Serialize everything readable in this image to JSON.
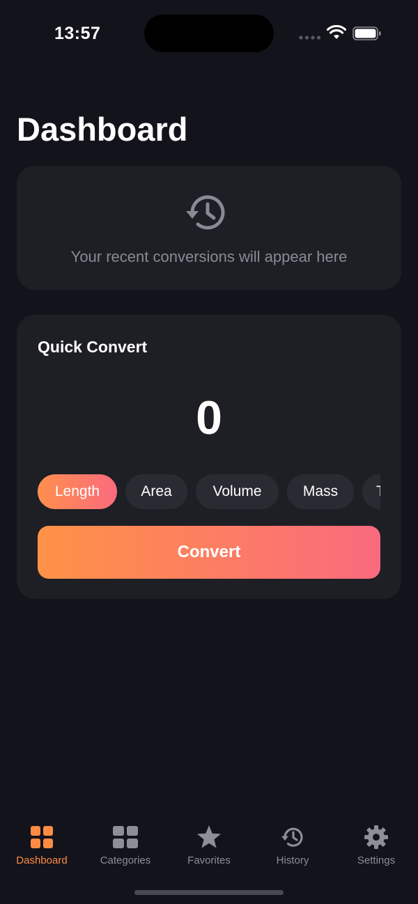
{
  "status_bar": {
    "time": "13:57"
  },
  "page": {
    "title": "Dashboard"
  },
  "recent": {
    "icon": "history-icon",
    "empty_message": "Your recent conversions will appear here"
  },
  "quick_convert": {
    "title": "Quick Convert",
    "value": "0",
    "categories": [
      {
        "label": "Length",
        "active": true
      },
      {
        "label": "Area",
        "active": false
      },
      {
        "label": "Volume",
        "active": false
      },
      {
        "label": "Mass",
        "active": false
      },
      {
        "label": "T",
        "active": false
      }
    ],
    "convert_label": "Convert"
  },
  "tab_bar": {
    "tabs": [
      {
        "label": "Dashboard",
        "icon": "grid-icon",
        "active": true
      },
      {
        "label": "Categories",
        "icon": "categories-icon",
        "active": false
      },
      {
        "label": "Favorites",
        "icon": "star-icon",
        "active": false
      },
      {
        "label": "History",
        "icon": "history-icon",
        "active": false
      },
      {
        "label": "Settings",
        "icon": "gear-icon",
        "active": false
      }
    ]
  },
  "colors": {
    "background": "#13131b",
    "card": "#1e1e25",
    "accent_start": "#ff9246",
    "accent_end": "#fa6a7e",
    "active_tab": "#ff8c42",
    "inactive": "#8e8e96"
  }
}
